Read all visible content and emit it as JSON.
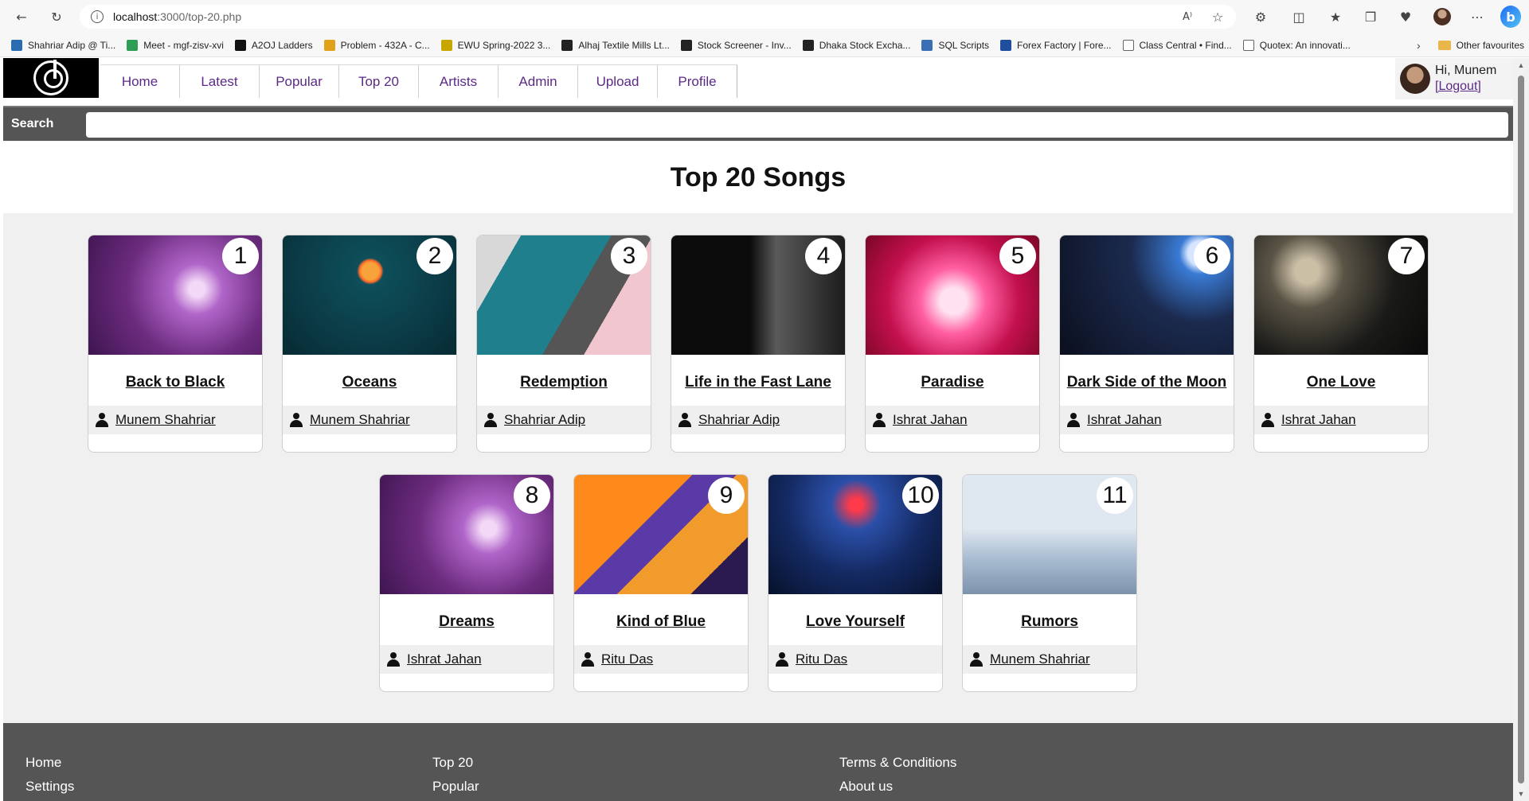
{
  "browser": {
    "url_host": "localhost",
    "url_path": ":3000/top-20.php",
    "bookmarks": [
      {
        "label": "Shahriar Adip @ Ti...",
        "color": "#2b6cb0"
      },
      {
        "label": "Meet - mgf-zisv-xvi",
        "color": "#2e9e57"
      },
      {
        "label": "A2OJ Ladders",
        "color": "#111111"
      },
      {
        "label": "Problem - 432A - C...",
        "color": "#e0a21b"
      },
      {
        "label": "EWU Spring-2022 3...",
        "color": "#c8a600"
      },
      {
        "label": "Alhaj Textile Mills Lt...",
        "color": "#222222"
      },
      {
        "label": "Stock Screener - Inv...",
        "color": "#222222"
      },
      {
        "label": "Dhaka Stock Excha...",
        "color": "#222222"
      },
      {
        "label": "SQL Scripts",
        "color": "#3a6fb5"
      },
      {
        "label": "Forex Factory | Fore...",
        "color": "#1f4e9c"
      },
      {
        "label": "Class Central • Find...",
        "color": "#555555"
      },
      {
        "label": "Quotex: An innovati...",
        "color": "#555555"
      }
    ],
    "other_favourites": "Other favourites"
  },
  "nav": {
    "items": [
      "Home",
      "Latest",
      "Popular",
      "Top 20",
      "Artists",
      "Admin",
      "Upload",
      "Profile"
    ]
  },
  "user": {
    "greeting": "Hi, Munem",
    "logout": "[Logout]"
  },
  "search": {
    "label": "Search",
    "value": ""
  },
  "page": {
    "title": "Top 20 Songs"
  },
  "songs": [
    {
      "rank": "1",
      "title": "Back to Black",
      "artist": "Munem Shahriar",
      "cover": "purple"
    },
    {
      "rank": "2",
      "title": "Oceans",
      "artist": "Munem Shahriar",
      "cover": "teal"
    },
    {
      "rank": "3",
      "title": "Redemption",
      "artist": "Shahriar Adip",
      "cover": "sea"
    },
    {
      "rank": "4",
      "title": "Life in the Fast Lane",
      "artist": "Shahriar Adip",
      "cover": "mono"
    },
    {
      "rank": "5",
      "title": "Paradise",
      "artist": "Ishrat Jahan",
      "cover": "pink"
    },
    {
      "rank": "6",
      "title": "Dark Side of the Moon",
      "artist": "Ishrat Jahan",
      "cover": "space"
    },
    {
      "rank": "7",
      "title": "One Love",
      "artist": "Ishrat Jahan",
      "cover": "stage"
    },
    {
      "rank": "8",
      "title": "Dreams",
      "artist": "Ishrat Jahan",
      "cover": "purple"
    },
    {
      "rank": "9",
      "title": "Kind of Blue",
      "artist": "Ritu Das",
      "cover": "orange"
    },
    {
      "rank": "10",
      "title": "Love Yourself",
      "artist": "Ritu Das",
      "cover": "night"
    },
    {
      "rank": "11",
      "title": "Rumors",
      "artist": "Munem Shahriar",
      "cover": "sky"
    }
  ],
  "footer": {
    "col1": [
      "Home",
      "Settings"
    ],
    "col2": [
      "Top 20",
      "Popular"
    ],
    "col3": [
      "Terms & Conditions",
      "About us"
    ]
  }
}
